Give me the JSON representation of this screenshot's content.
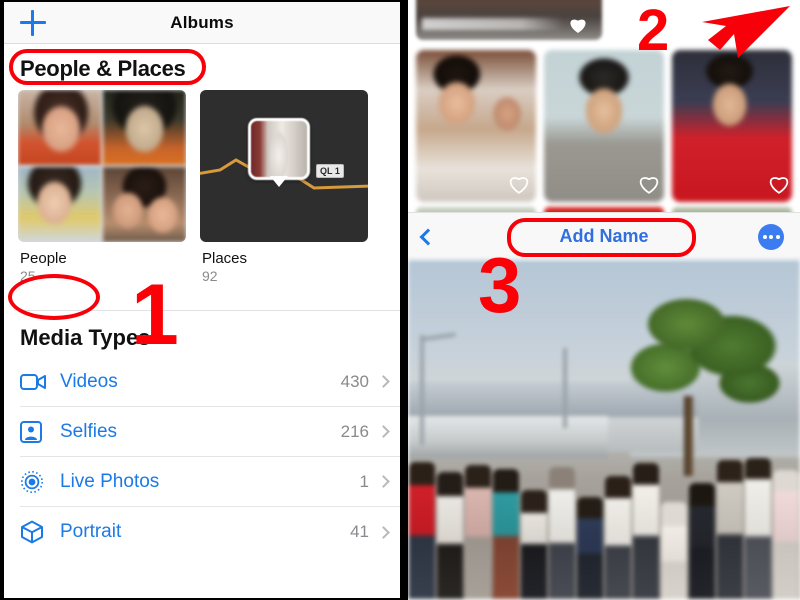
{
  "left": {
    "nav": {
      "title": "Albums",
      "add_icon": "plus-icon"
    },
    "section_people_places": "People & Places",
    "albums": [
      {
        "name": "People",
        "count": "25",
        "thumb": "people-faces-grid"
      },
      {
        "name": "Places",
        "count": "92",
        "thumb": "places-map",
        "map_label": "QL 1"
      }
    ],
    "section_media_types": "Media Types",
    "media_types": [
      {
        "label": "Videos",
        "count": "430",
        "icon": "video-camera-icon"
      },
      {
        "label": "Selfies",
        "count": "216",
        "icon": "selfie-person-icon"
      },
      {
        "label": "Live Photos",
        "count": "1",
        "icon": "live-photo-icon"
      },
      {
        "label": "Portrait",
        "count": "41",
        "icon": "portrait-cube-icon"
      }
    ]
  },
  "right": {
    "top_strip_photo": {
      "icon": "heart-icon",
      "caption": "blurred-caption"
    },
    "thumbnails": [
      {
        "name": "photo-two-people",
        "icon": "heart-icon"
      },
      {
        "name": "photo-portrait-suit",
        "icon": "heart-icon"
      },
      {
        "name": "photo-red-jacket",
        "icon": "heart-icon"
      }
    ],
    "toolbar": {
      "back_icon": "back-chevron-icon",
      "add_name_label": "Add Name",
      "more_icon": "more-options-icon"
    },
    "main_photo": "group-photo-airport"
  },
  "annotations": {
    "step1": "1",
    "step2": "2",
    "step3": "3",
    "highlight_color": "#f80009",
    "highlights": [
      "people-and-places-heading",
      "people-album-label",
      "add-name-button"
    ],
    "arrow": "red-arrow-down-left"
  }
}
